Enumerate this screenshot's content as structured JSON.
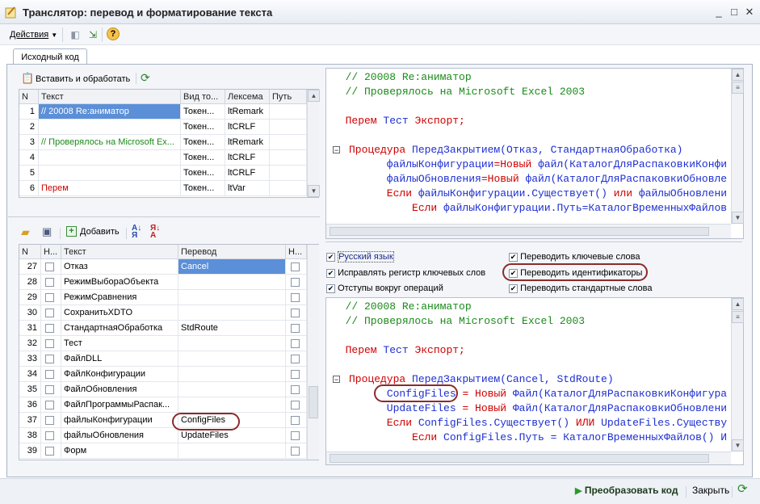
{
  "window": {
    "title": "Транслятор: перевод и форматирование текста",
    "controls": [
      "_",
      "□",
      "✕"
    ]
  },
  "toolbar": {
    "actions_label": "Действия",
    "help_icon": "?"
  },
  "tabs": [
    {
      "label": "Исходный код"
    }
  ],
  "source_toolbar": {
    "insert_label": "Вставить и обработать"
  },
  "tokens_grid": {
    "headers": [
      "N",
      "Текст",
      "Вид то...",
      "Лексема",
      "Путь"
    ],
    "rows": [
      {
        "n": "1",
        "text": "// 20008 Re:аниматор",
        "kind": "Токен...",
        "lex": "ltRemark",
        "path": "",
        "color": "#1a8a1a",
        "selected": true
      },
      {
        "n": "2",
        "text": "",
        "kind": "Токен...",
        "lex": "ltCRLF",
        "path": "",
        "color": "#000000",
        "selected": false
      },
      {
        "n": "3",
        "text": "// Проверялось на Microsoft Ex...",
        "kind": "Токен...",
        "lex": "ltRemark",
        "path": "",
        "color": "#1a8a1a",
        "selected": false
      },
      {
        "n": "4",
        "text": "",
        "kind": "Токен...",
        "lex": "ltCRLF",
        "path": "",
        "color": "#000000",
        "selected": false
      },
      {
        "n": "5",
        "text": "",
        "kind": "Токен...",
        "lex": "ltCRLF",
        "path": "",
        "color": "#000000",
        "selected": false
      },
      {
        "n": "6",
        "text": "Перем",
        "kind": "Токен...",
        "lex": "ltVar",
        "path": "",
        "color": "#d00000",
        "selected": false
      }
    ]
  },
  "ident_toolbar": {
    "add_label": "Добавить"
  },
  "ident_grid": {
    "headers": [
      "N",
      "Н...",
      "Текст",
      "Перевод",
      "Н..."
    ],
    "rows": [
      {
        "n": "27",
        "text": "Отказ",
        "translation": "Cancel",
        "selected": true
      },
      {
        "n": "28",
        "text": "РежимВыбораОбъекта",
        "translation": "",
        "selected": false
      },
      {
        "n": "29",
        "text": "РежимСравнения",
        "translation": "",
        "selected": false
      },
      {
        "n": "30",
        "text": "СохранитьXDTO",
        "translation": "",
        "selected": false
      },
      {
        "n": "31",
        "text": "СтандартнаяОбработка",
        "translation": "StdRoute",
        "selected": false
      },
      {
        "n": "32",
        "text": "Тест",
        "translation": "",
        "selected": false
      },
      {
        "n": "33",
        "text": "ФайлDLL",
        "translation": "",
        "selected": false
      },
      {
        "n": "34",
        "text": "ФайлКонфигурации",
        "translation": "",
        "selected": false
      },
      {
        "n": "35",
        "text": "ФайлОбновления",
        "translation": "",
        "selected": false
      },
      {
        "n": "36",
        "text": "ФайлПрограммыРаспак...",
        "translation": "",
        "selected": false
      },
      {
        "n": "37",
        "text": "файлыКонфигурации",
        "translation": "ConfigFiles",
        "selected": false
      },
      {
        "n": "38",
        "text": "файлыОбновления",
        "translation": "UpdateFiles",
        "selected": false
      },
      {
        "n": "39",
        "text": "Форм",
        "translation": "",
        "selected": false
      }
    ]
  },
  "options": {
    "russian": "Русский язык",
    "fix_case": "Исправлять регистр ключевых слов",
    "indent": "Отступы вокруг операций",
    "translate_keywords": "Переводить ключевые слова",
    "translate_identifiers": "Переводить идентификаторы",
    "translate_std": "Переводить стандартные слова"
  },
  "source_code": {
    "l1": "  // 20008 Re:аниматор",
    "l2": "  // Проверялось на Microsoft Excel 2003",
    "l3a": "  Перем ",
    "l3b": "Тест ",
    "l3c": "Экспорт;",
    "l4a": "Процедура ",
    "l4b": "ПередЗакрытием(",
    "l4c": "Отказ, СтандартнаяОбработка)",
    "l5a": "      файлыКонфигурации",
    "l5b": "=",
    "l5c": "Новый ",
    "l5d": "файл(КаталогДляРаспаковкиКонфи",
    "l6a": "      файлыОбновления",
    "l6b": "=",
    "l6c": "Новый ",
    "l6d": "файл(КаталогДляРаспаковкиОбновле",
    "l7a": "      Если ",
    "l7b": "файлыКонфигурации.Существует() ",
    "l7c": "или ",
    "l7d": "файлыОбновлени",
    "l8a": "          Если ",
    "l8b": "файлыКонфигурации.Путь=КаталогВременныхФайлов"
  },
  "result_code": {
    "l1": "  // 20008 Re:аниматор",
    "l2": "  // Проверялось на Microsoft Excel 2003",
    "l3a": "  Перем ",
    "l3b": "Тест ",
    "l3c": "Экспорт;",
    "l4a": "Процедура ",
    "l4b": "ПередЗакрытием(Cancel, StdRoute)",
    "l5a": "ConfigFiles",
    "l5b": " = ",
    "l5c": "Новый ",
    "l5d": "Файл(КаталогДляРаспаковкиКонфигура",
    "l6a": "      UpdateFiles",
    "l6b": " = ",
    "l6c": "Новый ",
    "l6d": "Файл(КаталогДляРаспаковкиОбновлени",
    "l7a": "      Если ",
    "l7b": "ConfigFiles.Существует() ",
    "l7c": "ИЛИ ",
    "l7d": "UpdateFiles.Существу",
    "l8a": "          Если ",
    "l8b": "ConfigFiles.Путь = КаталогВременныхФайлов() И"
  },
  "bottom": {
    "convert_label": "Преобразовать код",
    "close_label": "Закрыть"
  }
}
